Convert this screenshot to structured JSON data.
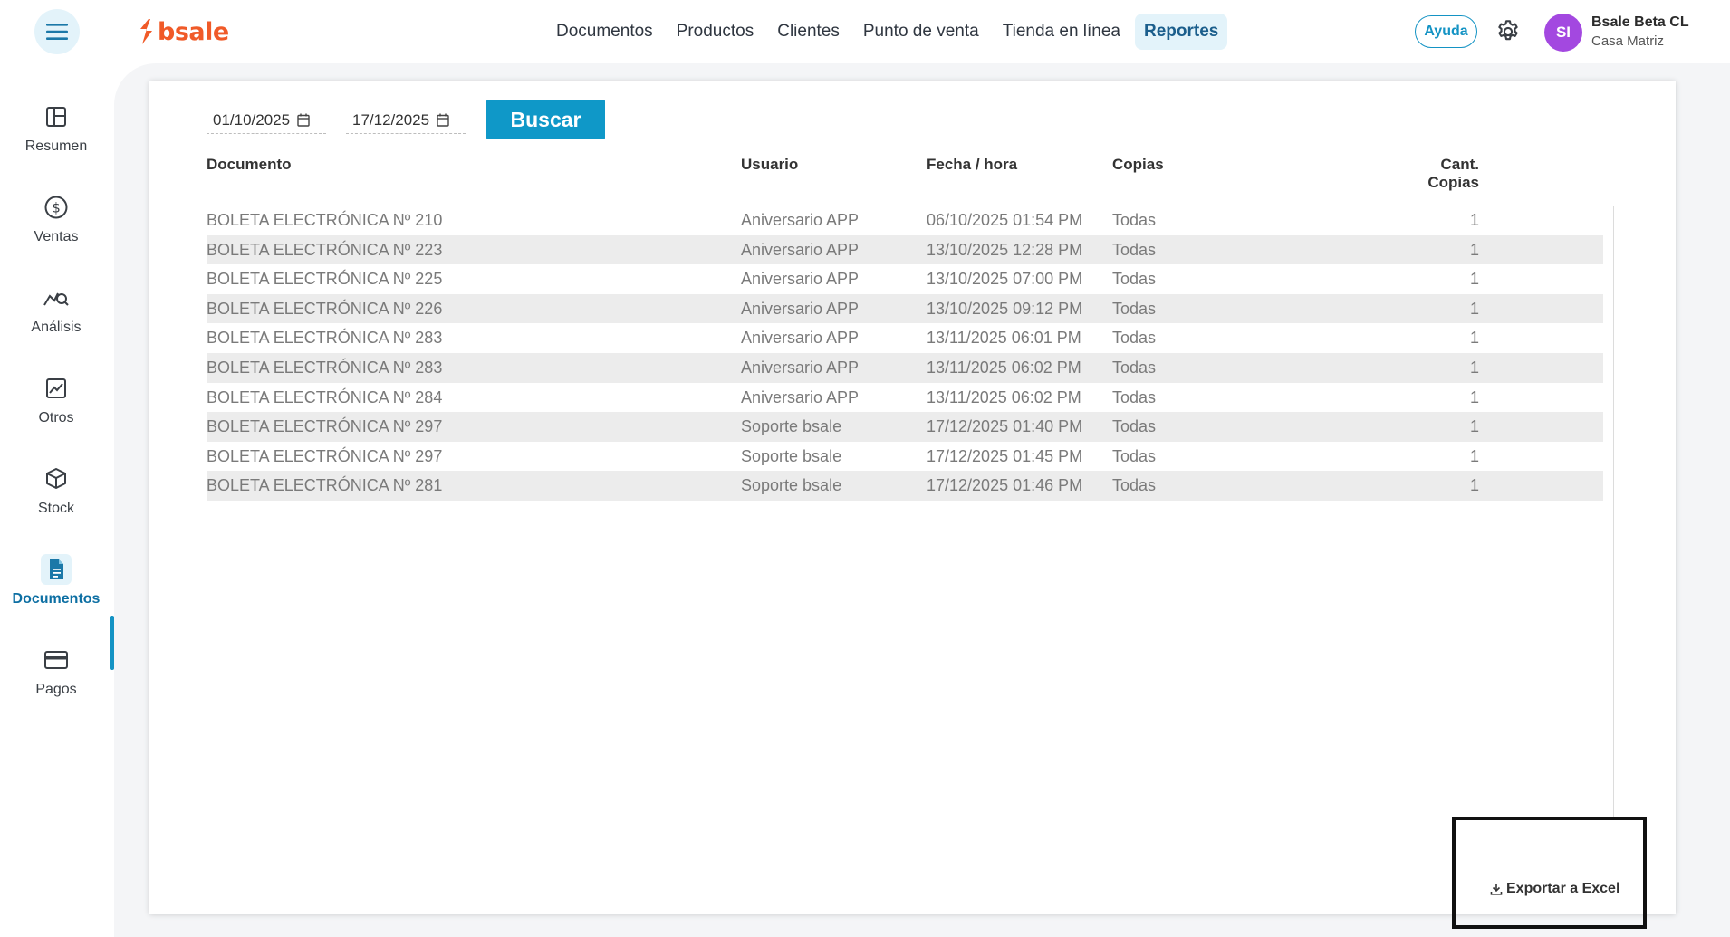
{
  "header": {
    "logo_text": "bsale",
    "nav": [
      {
        "label": "Documentos"
      },
      {
        "label": "Productos"
      },
      {
        "label": "Clientes"
      },
      {
        "label": "Punto de venta"
      },
      {
        "label": "Tienda en línea"
      },
      {
        "label": "Reportes"
      }
    ],
    "active_nav": "Reportes",
    "help_label": "Ayuda",
    "avatar_initials": "SI",
    "user_name": "Bsale Beta CL",
    "user_branch": "Casa Matriz"
  },
  "sidebar": {
    "items": [
      {
        "label": "Resumen",
        "icon": "layout-icon"
      },
      {
        "label": "Ventas",
        "icon": "dollar-circle-icon"
      },
      {
        "label": "Análisis",
        "icon": "chart-search-icon"
      },
      {
        "label": "Otros",
        "icon": "trend-chart-icon"
      },
      {
        "label": "Stock",
        "icon": "box-icon"
      },
      {
        "label": "Documentos",
        "icon": "document-icon"
      },
      {
        "label": "Pagos",
        "icon": "card-icon"
      }
    ],
    "active": "Documentos"
  },
  "filters": {
    "date_from": "01/10/2025",
    "date_to": "17/12/2025",
    "search_label": "Buscar"
  },
  "table": {
    "headers": [
      "Documento",
      "Usuario",
      "Fecha / hora",
      "Copias",
      "Cant. Copias"
    ],
    "rows": [
      [
        "BOLETA ELECTRÓNICA Nº 210",
        "Aniversario APP",
        "06/10/2025 01:54 PM",
        "Todas",
        "1"
      ],
      [
        "BOLETA ELECTRÓNICA Nº 223",
        "Aniversario APP",
        "13/10/2025 12:28 PM",
        "Todas",
        "1"
      ],
      [
        "BOLETA ELECTRÓNICA Nº 225",
        "Aniversario APP",
        "13/10/2025 07:00 PM",
        "Todas",
        "1"
      ],
      [
        "BOLETA ELECTRÓNICA Nº 226",
        "Aniversario APP",
        "13/10/2025 09:12 PM",
        "Todas",
        "1"
      ],
      [
        "BOLETA ELECTRÓNICA Nº 283",
        "Aniversario APP",
        "13/11/2025 06:01 PM",
        "Todas",
        "1"
      ],
      [
        "BOLETA ELECTRÓNICA Nº 283",
        "Aniversario APP",
        "13/11/2025 06:02 PM",
        "Todas",
        "1"
      ],
      [
        "BOLETA ELECTRÓNICA Nº 284",
        "Aniversario APP",
        "13/11/2025 06:02 PM",
        "Todas",
        "1"
      ],
      [
        "BOLETA ELECTRÓNICA Nº 297",
        "Soporte bsale",
        "17/12/2025 01:40 PM",
        "Todas",
        "1"
      ],
      [
        "BOLETA ELECTRÓNICA Nº 297",
        "Soporte bsale",
        "17/12/2025 01:45 PM",
        "Todas",
        "1"
      ],
      [
        "BOLETA ELECTRÓNICA Nº 281",
        "Soporte bsale",
        "17/12/2025 01:46 PM",
        "Todas",
        "1"
      ]
    ]
  },
  "export": {
    "label": "Exportar a Excel",
    "icon": "download-icon"
  },
  "colors": {
    "accent": "#0f98c8",
    "brand": "#f05a28",
    "avatar": "#a348e0"
  }
}
